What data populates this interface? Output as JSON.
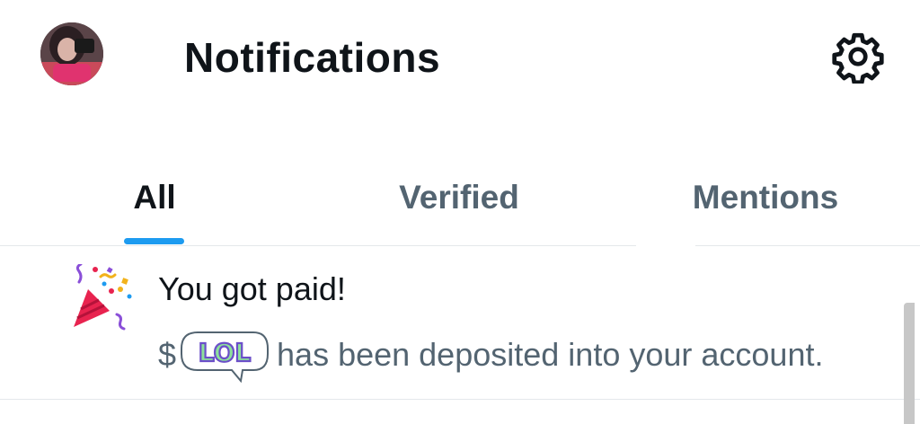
{
  "header": {
    "title": "Notifications",
    "avatar_icon": "user-avatar",
    "settings_icon": "gear-icon"
  },
  "tabs": [
    {
      "label": "All",
      "active": true
    },
    {
      "label": "Verified",
      "active": false
    },
    {
      "label": "Mentions",
      "active": false
    }
  ],
  "notification": {
    "icon": "party-popper-icon",
    "title": "You got paid!",
    "currency_symbol": "$",
    "sticker_text": "LOL",
    "body_suffix": "has been deposited into your account."
  },
  "colors": {
    "accent": "#1d9bf0",
    "text_primary": "#0f1419",
    "text_secondary": "#536471",
    "divider": "#e4e8eb"
  }
}
